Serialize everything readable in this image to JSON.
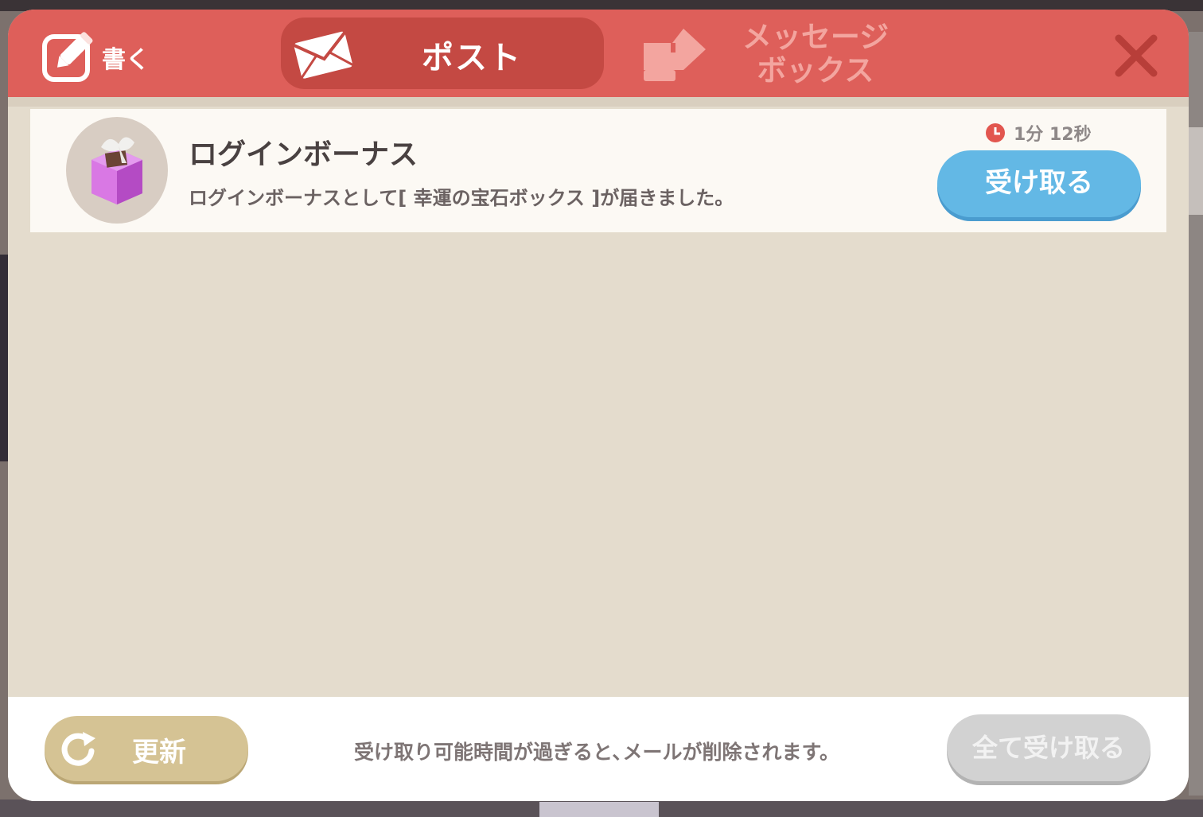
{
  "header": {
    "write_label": "書く",
    "tabs": [
      {
        "label": "ポスト",
        "active": true
      },
      {
        "label": "メッセージ\nボックス",
        "active": false
      }
    ]
  },
  "mail_list": [
    {
      "title": "ログインボーナス",
      "body": "ログインボーナスとして[ 幸運の宝石ボックス ]が届きました。",
      "timer": "1分 12秒",
      "action_label": "受け取る"
    }
  ],
  "footer": {
    "refresh_label": "更新",
    "notice": "受け取り可能時間が過ぎると､メールが削除されます。",
    "receive_all_label": "全て受け取る"
  },
  "colors": {
    "header": "#de5f5a",
    "active_tab": "#c44943",
    "receive_button": "#63b8e5",
    "refresh_button": "#d5c394",
    "disabled_button": "#d2d2d2"
  },
  "icons": [
    "pencil-icon",
    "envelope-icon",
    "message-box-icon",
    "close-icon",
    "gift-box-icon",
    "clock-icon",
    "refresh-icon"
  ]
}
